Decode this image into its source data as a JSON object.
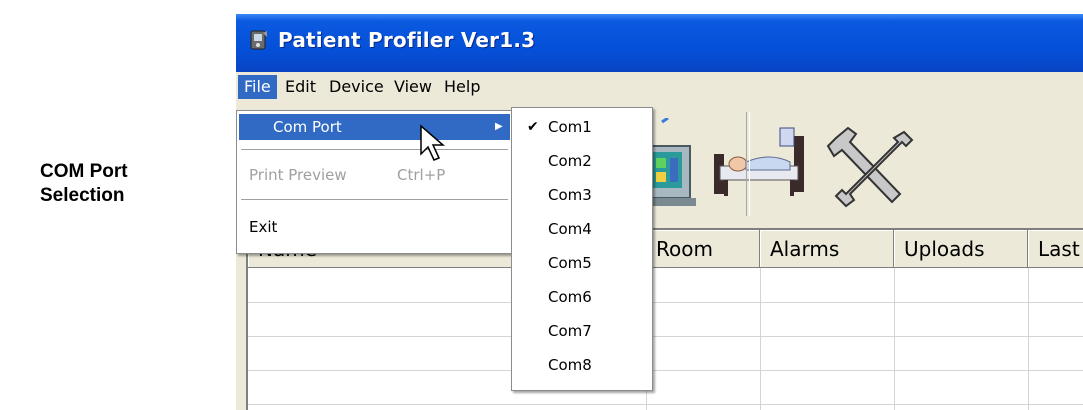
{
  "caption": {
    "line1": "COM Port",
    "line2": "Selection"
  },
  "window": {
    "title": "Patient Profiler Ver1.3",
    "icon": "app-icon"
  },
  "menubar": {
    "items": [
      {
        "label": "File",
        "active": true
      },
      {
        "label": "Edit"
      },
      {
        "label": "Device"
      },
      {
        "label": "View"
      },
      {
        "label": "Help"
      }
    ]
  },
  "toolbar": {
    "icons": [
      "monitor-icon",
      "patient-bed-icon",
      "tools-icon"
    ]
  },
  "file_menu": {
    "items": [
      {
        "label": "Com Port",
        "highlighted": true,
        "has_submenu": true
      },
      {
        "label": "Print Preview",
        "shortcut": "Ctrl+P",
        "disabled": true
      },
      {
        "label": "Exit"
      }
    ]
  },
  "com_port_menu": {
    "items": [
      {
        "label": "Com1",
        "checked": true
      },
      {
        "label": "Com2"
      },
      {
        "label": "Com3"
      },
      {
        "label": "Com4"
      },
      {
        "label": "Com5"
      },
      {
        "label": "Com6"
      },
      {
        "label": "Com7"
      },
      {
        "label": "Com8"
      }
    ]
  },
  "grid": {
    "columns": [
      "Name",
      "Room",
      "Alarms",
      "Uploads",
      "Last"
    ]
  },
  "colors": {
    "titlebar": "#0550d8",
    "highlight": "#316ac5",
    "chrome": "#ece9d8"
  }
}
